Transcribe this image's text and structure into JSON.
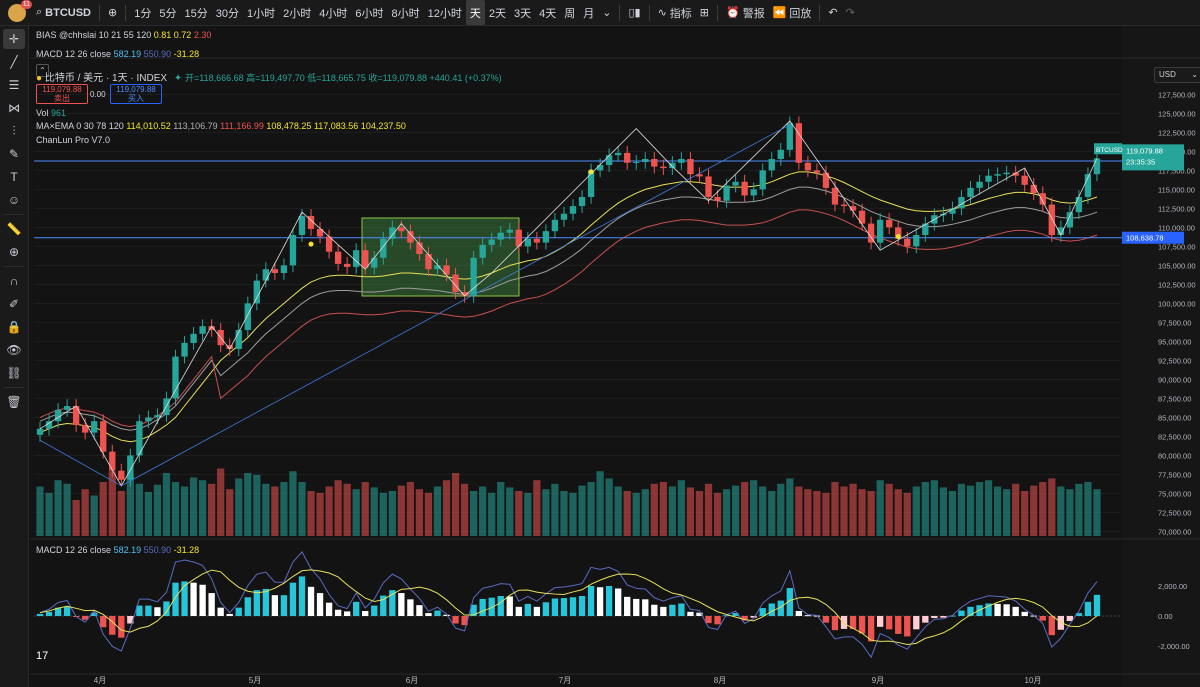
{
  "toolbar": {
    "avatar_badge": "11",
    "symbol": "BTCUSD",
    "intervals": [
      "1分",
      "5分",
      "15分",
      "30分",
      "1小时",
      "2小时",
      "4小时",
      "6小时",
      "8小时",
      "12小时",
      "天",
      "2天",
      "3天",
      "4天",
      "周",
      "月"
    ],
    "active_interval": "天",
    "indicators_label": "指标",
    "alert_label": "警报",
    "replay_label": "回放"
  },
  "legend": {
    "bias_name": "BIAS @chhslai 10 21 55 120",
    "bias_v1": "0.81",
    "bias_v2": "0.72",
    "bias_v3": "2.30",
    "macd_top_name": "MACD 12 26 close",
    "macd_v1": "582.19",
    "macd_v2": "550.90",
    "macd_v3": "-31.28",
    "title": "比特币 / 美元 · 1天 · INDEX",
    "ohlc": "开=118,666.68 高=119,497.70 低=118,665.75 收=119,079.88 +440.41 (+0.37%)",
    "sell_price": "119,079.88",
    "sell_label": "卖出",
    "spread": "0.00",
    "buy_price": "119,079.88",
    "buy_label": "买入",
    "vol_name": "Vol",
    "vol_value": "961",
    "ma_name": "MA×EMA 0 30 78 120",
    "ma_v1": "114,010.52",
    "ma_v2": "113,106.79",
    "ma_v3": "111,166.99",
    "ma_v4": "108,478.25",
    "ma_v5": "117,083.56",
    "ma_v6": "104,237.50",
    "chanlun": "ChanLun Pro V7.0",
    "macd_bottom_name": "MACD 12 26 close",
    "currency": "USD"
  },
  "colors": {
    "up": "#26a69a",
    "down": "#ef5350",
    "bg": "#131313",
    "grid": "#1f1f1f",
    "hline": "#2962ff"
  },
  "chart_data": {
    "type": "candlestick",
    "y_ticks": [
      "127,500.00",
      "125,000.00",
      "122,500.00",
      "120,000.00",
      "117,500.00",
      "115,000.00",
      "112,500.00",
      "110,000.00",
      "107,500.00",
      "105,000.00",
      "102,500.00",
      "100,000.00",
      "97,500.00",
      "95,000.00",
      "92,500.00",
      "90,000.00",
      "87,500.00",
      "85,000.00",
      "82,500.00",
      "80,000.00",
      "77,500.00",
      "75,000.00",
      "72,500.00",
      "70,000.00"
    ],
    "macd_ticks": [
      "2,000.00",
      "0.00",
      "-2,000.00"
    ],
    "x_labels": [
      "4月",
      "5月",
      "6月",
      "7月",
      "8月",
      "9月",
      "10月"
    ],
    "last_price_label": "BTCUSD",
    "last_price": "119,079.88",
    "countdown": "23:35:35",
    "line1_price": "118,725.52",
    "line2_price": "108,638.78",
    "price_path": [
      83500,
      84500,
      86000,
      86500,
      84000,
      83000,
      84500,
      80500,
      78000,
      76800,
      80000,
      84500,
      85000,
      85300,
      87500,
      93000,
      94800,
      96000,
      97000,
      96500,
      94500,
      94000,
      96500,
      100000,
      103000,
      104500,
      104000,
      105000,
      109000,
      111500,
      109800,
      108800,
      106800,
      105200,
      104800,
      107000,
      104700,
      106000,
      108500,
      110000,
      109500,
      108000,
      106500,
      104500,
      105000,
      103800,
      101500,
      101000,
      106000,
      107700,
      108400,
      109300,
      109700,
      107500,
      108500,
      108000,
      109500,
      111000,
      111800,
      112800,
      114000,
      117500,
      118200,
      119500,
      119800,
      118500,
      118600,
      119000,
      118000,
      117800,
      118500,
      119000,
      117000,
      116700,
      114000,
      113500,
      115500,
      116000,
      114200,
      115000,
      117500,
      119000,
      120200,
      123700,
      118500,
      117500,
      117200,
      115200,
      113000,
      112800,
      112200,
      110500,
      108000,
      111000,
      110000,
      108500,
      107500,
      109000,
      110500,
      111600,
      111800,
      112500,
      114000,
      115200,
      116000,
      116800,
      117000,
      117200,
      116800,
      115600,
      114500,
      113000,
      109000,
      110000,
      112000,
      114000,
      117000,
      119080
    ],
    "volumes": [
      55,
      48,
      62,
      58,
      40,
      52,
      45,
      60,
      72,
      50,
      66,
      58,
      49,
      57,
      70,
      60,
      55,
      65,
      62,
      58,
      75,
      52,
      64,
      70,
      68,
      58,
      55,
      60,
      72,
      60,
      50,
      48,
      55,
      62,
      58,
      52,
      60,
      54,
      48,
      50,
      56,
      60,
      52,
      48,
      55,
      62,
      70,
      58,
      50,
      55,
      48,
      60,
      54,
      50,
      48,
      62,
      52,
      58,
      50,
      48,
      56,
      60,
      72,
      64,
      55,
      50,
      48,
      52,
      58,
      60,
      55,
      62,
      54,
      50,
      58,
      48,
      52,
      56,
      60,
      62,
      55,
      50,
      58,
      64,
      55,
      52,
      50,
      48,
      60,
      55,
      58,
      52,
      50,
      62,
      58,
      52,
      48,
      55,
      60,
      62,
      54,
      50,
      58,
      56,
      60,
      62,
      55,
      52,
      58,
      50,
      56,
      60,
      64,
      55,
      52,
      58,
      60,
      52
    ],
    "series_ma": [
      83000,
      83500,
      84000,
      84200,
      84100,
      83900,
      83700,
      83200,
      82500,
      82000,
      81800,
      82000,
      82500,
      83200,
      84000,
      85000,
      86500,
      88000,
      89500,
      91000,
      92500,
      93500,
      94500,
      95500,
      96800,
      98000,
      99000,
      100000,
      101000,
      102000,
      102800,
      103300,
      103600,
      103700,
      103700,
      103600,
      103500,
      103500,
      103600,
      103800,
      104000,
      104000,
      103900,
      103800,
      103700,
      103500,
      103300,
      103200,
      103300,
      103600,
      104000,
      104500,
      105000,
      105300,
      105600,
      105800,
      106200,
      106800,
      107500,
      108300,
      109200,
      110300,
      111300,
      112300,
      113200,
      113900,
      114500,
      115000,
      115300,
      115600,
      115800,
      116000,
      116000,
      115900,
      115700,
      115500,
      115300,
      115300,
      115300,
      115400,
      115600,
      116000,
      116500,
      117000,
      117300,
      117300,
      117100,
      116800,
      116400,
      115900,
      115300,
      114700,
      114100,
      113600,
      113200,
      112800,
      112400,
      112200,
      112100,
      112100,
      112200,
      112400,
      112700,
      113000,
      113400,
      113800,
      114100,
      114400,
      114600,
      114600,
      114400,
      114100,
      113600,
      113300,
      113200,
      113300,
      113600,
      114000
    ]
  }
}
